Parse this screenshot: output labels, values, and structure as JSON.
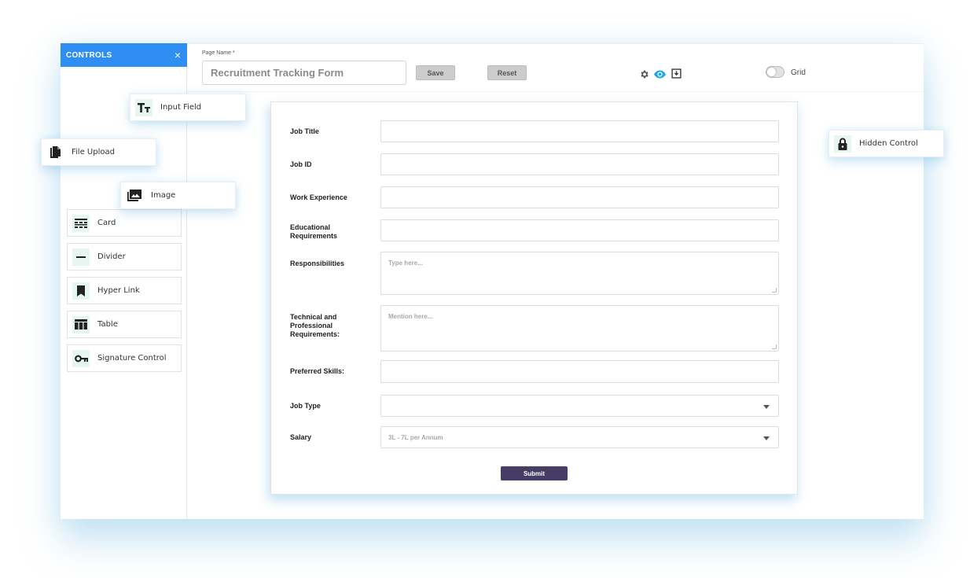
{
  "controls_panel": {
    "title": "CONTROLS",
    "close_symbol": "×",
    "items": [
      {
        "label": "Input Field",
        "icon": "text-format-icon"
      },
      {
        "label": "File Upload",
        "icon": "file-copy-icon"
      },
      {
        "label": "Image",
        "icon": "image-icon"
      },
      {
        "label": "Card",
        "icon": "card-icon"
      },
      {
        "label": "Divider",
        "icon": "divider-icon"
      },
      {
        "label": "Hyper Link",
        "icon": "bookmark-icon"
      },
      {
        "label": "Table",
        "icon": "table-icon"
      },
      {
        "label": "Signature Control",
        "icon": "key-icon"
      },
      {
        "label": "Hidden Control",
        "icon": "lock-icon"
      }
    ]
  },
  "toolbar": {
    "page_name_label": "Page Name *",
    "page_name_value": "Recruitment Tracking Form",
    "save_label": "Save",
    "reset_label": "Reset",
    "grid_label": "Grid",
    "grid_enabled": false
  },
  "form": {
    "fields": [
      {
        "label": "Job Title",
        "type": "text",
        "placeholder": ""
      },
      {
        "label": "Job ID",
        "type": "text",
        "placeholder": ""
      },
      {
        "label": "Work Experience",
        "type": "text",
        "placeholder": ""
      },
      {
        "label": "Educational Requirements",
        "type": "text",
        "placeholder": ""
      },
      {
        "label": "Responsibilities",
        "type": "textarea",
        "placeholder": "Type here..."
      },
      {
        "label": "Technical and Professional Requirements:",
        "type": "textarea",
        "placeholder": "Mention here..."
      },
      {
        "label": "Preferred Skills:",
        "type": "text",
        "placeholder": ""
      },
      {
        "label": "Job Type",
        "type": "select",
        "placeholder": ""
      },
      {
        "label": "Salary",
        "type": "select",
        "placeholder": "3L - 7L per Annum"
      }
    ],
    "submit_label": "Submit"
  },
  "colors": {
    "header_blue": "#2f8ef2",
    "icon_bg": "#e6f7f1",
    "eye_accent": "#1ea7e8",
    "submit_bg": "#453d66"
  }
}
